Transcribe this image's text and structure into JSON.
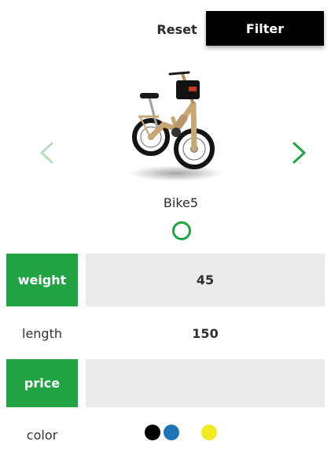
{
  "toolbar": {
    "reset_label": "Reset",
    "filter_label": "Filter"
  },
  "carousel": {
    "prev_icon": "chevron-left-icon",
    "next_icon": "chevron-right-icon",
    "prev_color": "#b3dfbf",
    "next_color": "#21a343"
  },
  "product": {
    "name": "Bike5",
    "image": "folding-ebike-image",
    "selected": false
  },
  "attributes": {
    "weight": {
      "label": "weight",
      "value": "45"
    },
    "length": {
      "label": "length",
      "value": "150"
    },
    "price": {
      "label": "price",
      "value": ""
    },
    "color": {
      "label": "color",
      "swatches": [
        "#000000",
        "#1f73b7",
        "#f2ea1e"
      ]
    }
  },
  "colors": {
    "accent": "#21a343",
    "row_shade": "#ebebeb",
    "filter_bg": "#000000"
  }
}
